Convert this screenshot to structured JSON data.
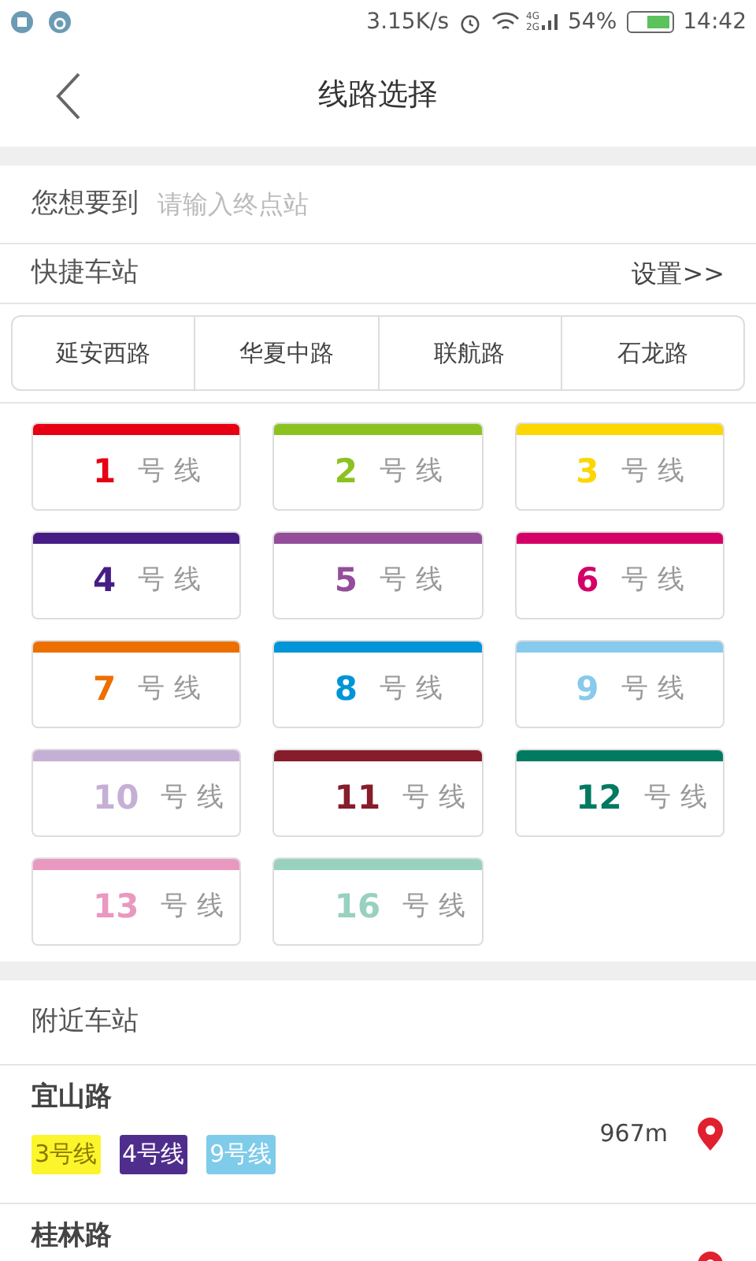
{
  "status_bar": {
    "speed": "3.15K/s",
    "net_top": "4G",
    "net_bottom": "2G",
    "battery": "54%",
    "time": "14:42"
  },
  "header": {
    "title": "线路选择"
  },
  "destination": {
    "label": "您想要到",
    "placeholder": "请输入终点站"
  },
  "quick": {
    "label": "快捷车站",
    "settings": "设置>>",
    "stations": [
      "延安西路",
      "华夏中路",
      "联航路",
      "石龙路"
    ]
  },
  "lines": [
    {
      "number": "1",
      "suffix": "号线",
      "color": "#e60012"
    },
    {
      "number": "2",
      "suffix": "号线",
      "color": "#8cc220"
    },
    {
      "number": "3",
      "suffix": "号线",
      "color": "#fcd600"
    },
    {
      "number": "4",
      "suffix": "号线",
      "color": "#461d84"
    },
    {
      "number": "5",
      "suffix": "号线",
      "color": "#944d9a"
    },
    {
      "number": "6",
      "suffix": "号线",
      "color": "#d40068"
    },
    {
      "number": "7",
      "suffix": "号线",
      "color": "#ed6f00"
    },
    {
      "number": "8",
      "suffix": "号线",
      "color": "#0094d8"
    },
    {
      "number": "9",
      "suffix": "号线",
      "color": "#87caed"
    },
    {
      "number": "10",
      "suffix": "号线",
      "color": "#c6afd4"
    },
    {
      "number": "11",
      "suffix": "号线",
      "color": "#871c2b"
    },
    {
      "number": "12",
      "suffix": "号线",
      "color": "#007a60"
    },
    {
      "number": "13",
      "suffix": "号线",
      "color": "#e999c0"
    },
    {
      "number": "16",
      "suffix": "号线",
      "color": "#98d1c0"
    }
  ],
  "nearby": {
    "title": "附近车站",
    "stations": [
      {
        "name": "宜山路",
        "distance": "967m",
        "lines": [
          {
            "label": "3号线",
            "color": "#fcf52b"
          },
          {
            "label": "4号线",
            "color": "#4f2d8c"
          },
          {
            "label": "9号线",
            "color": "#7ecbea"
          }
        ]
      },
      {
        "name": "桂林路"
      }
    ]
  }
}
